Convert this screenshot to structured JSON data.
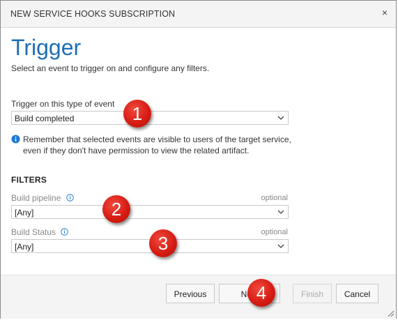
{
  "dialog": {
    "title": "NEW SERVICE HOOKS SUBSCRIPTION",
    "close_glyph": "×"
  },
  "page": {
    "heading": "Trigger",
    "description": "Select an event to trigger on and configure any filters."
  },
  "trigger": {
    "label": "Trigger on this type of event",
    "selected": "Build completed"
  },
  "info": {
    "line1": "Remember that selected events are visible to users of the target service,",
    "line2": "even if they don't have permission to view the related artifact."
  },
  "filters": {
    "title": "FILTERS",
    "build_pipeline": {
      "label": "Build pipeline",
      "optional": "optional",
      "selected": "[Any]"
    },
    "build_status": {
      "label": "Build Status",
      "optional": "optional",
      "selected": "[Any]"
    }
  },
  "footer": {
    "previous": "Previous",
    "next": "Next",
    "finish": "Finish",
    "cancel": "Cancel"
  },
  "markers": [
    "1",
    "2",
    "3",
    "4"
  ],
  "colors": {
    "heading_blue": "#1e6fb5",
    "marker_red": "#d61d14",
    "info_blue": "#1e7ad6"
  },
  "icons": {
    "close": "close-icon",
    "chevron": "chevron-down-icon",
    "info": "info-icon",
    "resize": "resize-grip-icon"
  }
}
